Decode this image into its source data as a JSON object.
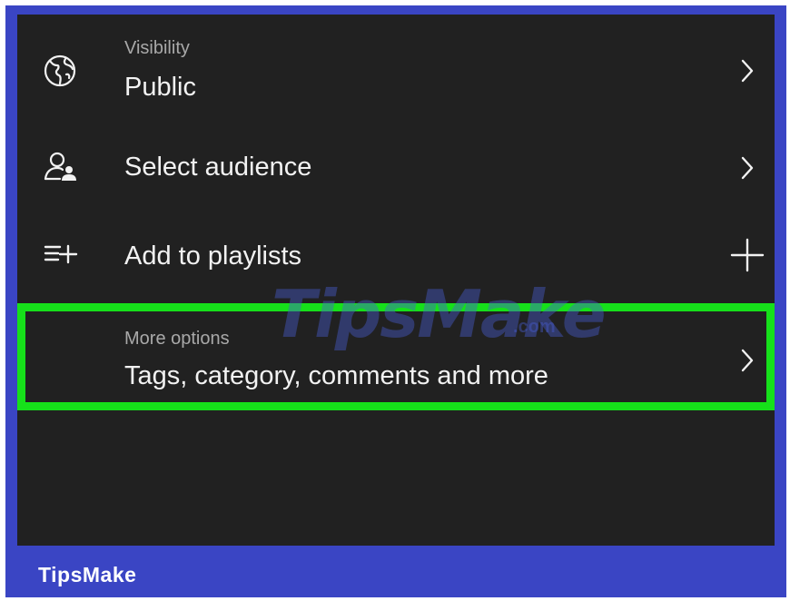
{
  "rows": {
    "visibility": {
      "sublabel": "Visibility",
      "label": "Public",
      "icon": "globe-icon",
      "action_icon": "chevron-right-icon"
    },
    "audience": {
      "label": "Select audience",
      "icon": "audience-icon",
      "action_icon": "chevron-right-icon"
    },
    "playlists": {
      "label": "Add to playlists",
      "icon": "playlist-add-icon",
      "action_icon": "plus-icon"
    },
    "more_options": {
      "sublabel": "More options",
      "label": "Tags, category, comments and more",
      "icon": "",
      "action_icon": "chevron-right-icon",
      "highlighted": true
    }
  },
  "watermark": {
    "text": "TipsMake",
    "suffix": ".com"
  },
  "footer": {
    "brand": "TipsMake"
  },
  "colors": {
    "background": "#212121",
    "frame": "#3a45c4",
    "highlight": "#16e01a",
    "text_primary": "#f2f2f2",
    "text_secondary": "#a9a9a9"
  }
}
